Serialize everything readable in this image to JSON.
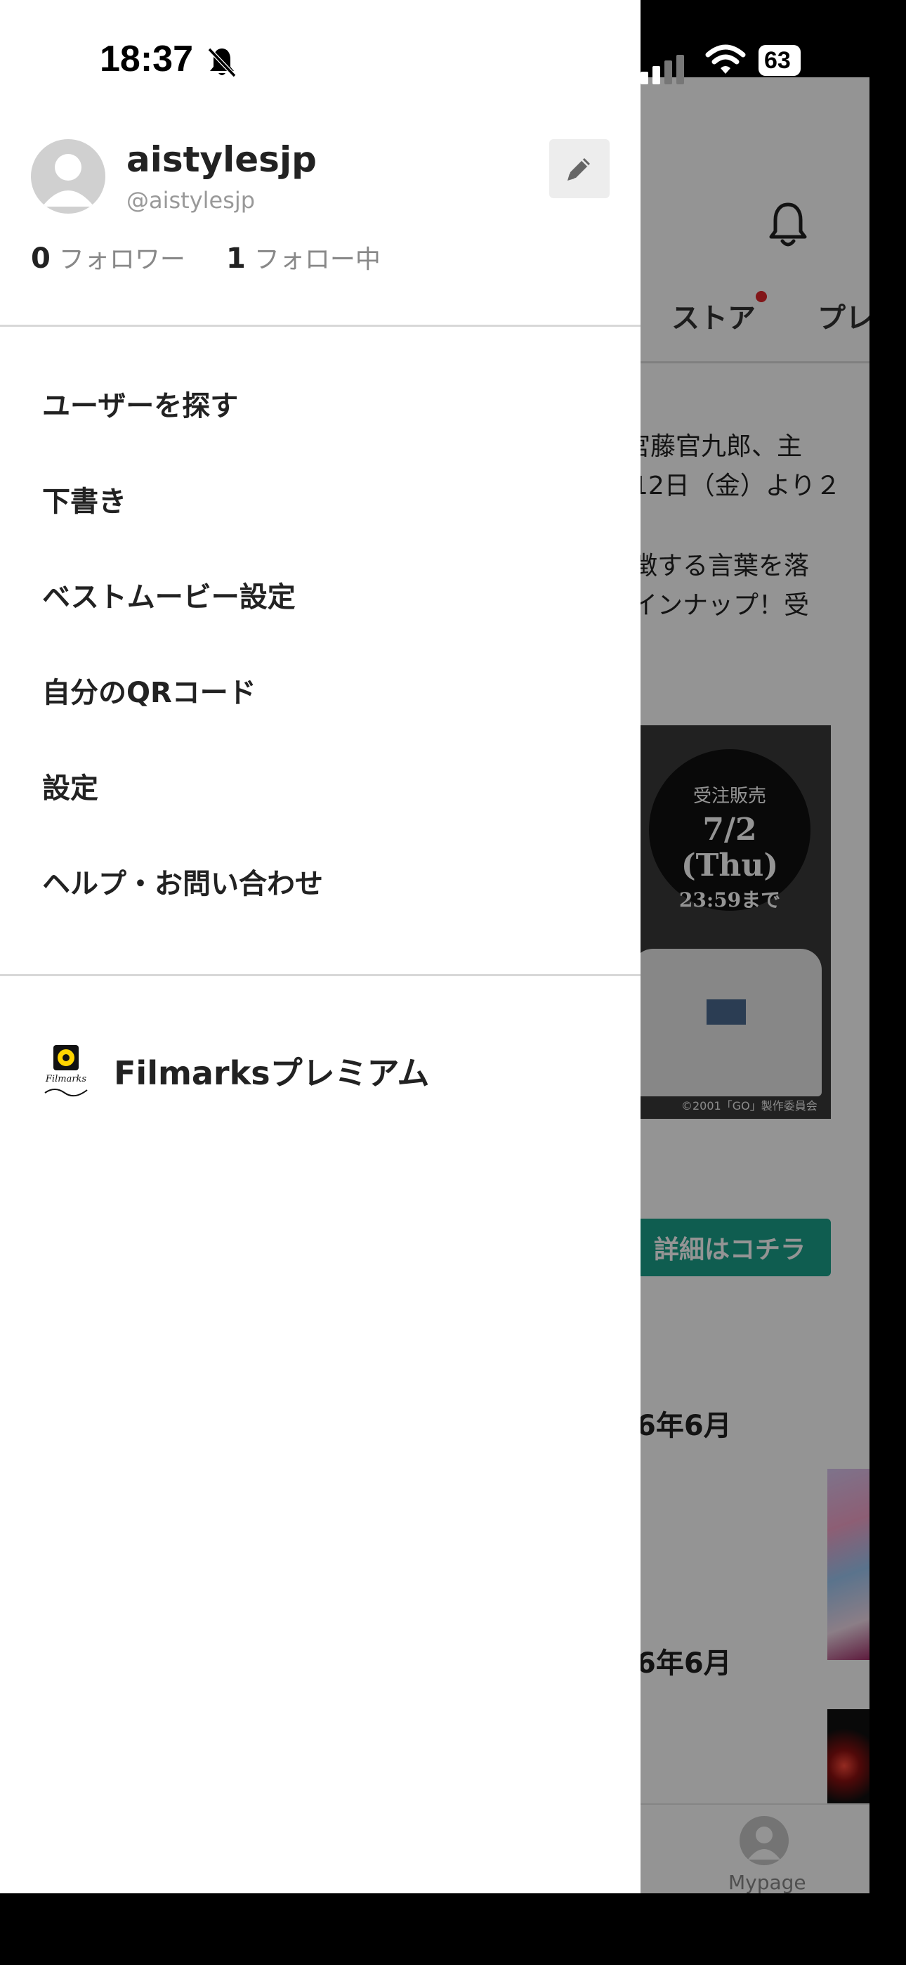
{
  "status_bar": {
    "time": "18:37",
    "battery": "63"
  },
  "profile": {
    "display_name": "aistylesjp",
    "handle": "@aistylesjp",
    "followers_count": "0",
    "followers_label": "フォロワー",
    "following_count": "1",
    "following_label": "フォロー中"
  },
  "menu": {
    "items": [
      {
        "label": "ユーザーを探す"
      },
      {
        "label": "下書き"
      },
      {
        "label": "ベストムービー設定"
      },
      {
        "label": "自分のQRコード"
      },
      {
        "label": "設定"
      },
      {
        "label": "ヘルプ・お問い合わせ"
      }
    ],
    "premium_label": "Filmarksプレミアム",
    "premium_logo_text": "Filmarks プレミアム"
  },
  "background_app": {
    "tabs": [
      "ストア",
      "プレ"
    ],
    "text_lines": [
      "宮藤官九郎、主",
      "12日（金）より２",
      "徴する言葉を落",
      "インナップ！受"
    ],
    "banner": {
      "line1": "受注販売",
      "line2": "7/2 (Thu)",
      "line3": "23:59まで",
      "copyright": "©2001「GO」製作委員会"
    },
    "detail_button": "詳細はコチラ",
    "date_labels": [
      "6年6月",
      "6年6月"
    ],
    "tabbar_label": "Mypage"
  },
  "colors": {
    "accent_green": "#1aa08b",
    "notification_dot": "#e0262b",
    "drawer_bg": "#ffffff"
  }
}
